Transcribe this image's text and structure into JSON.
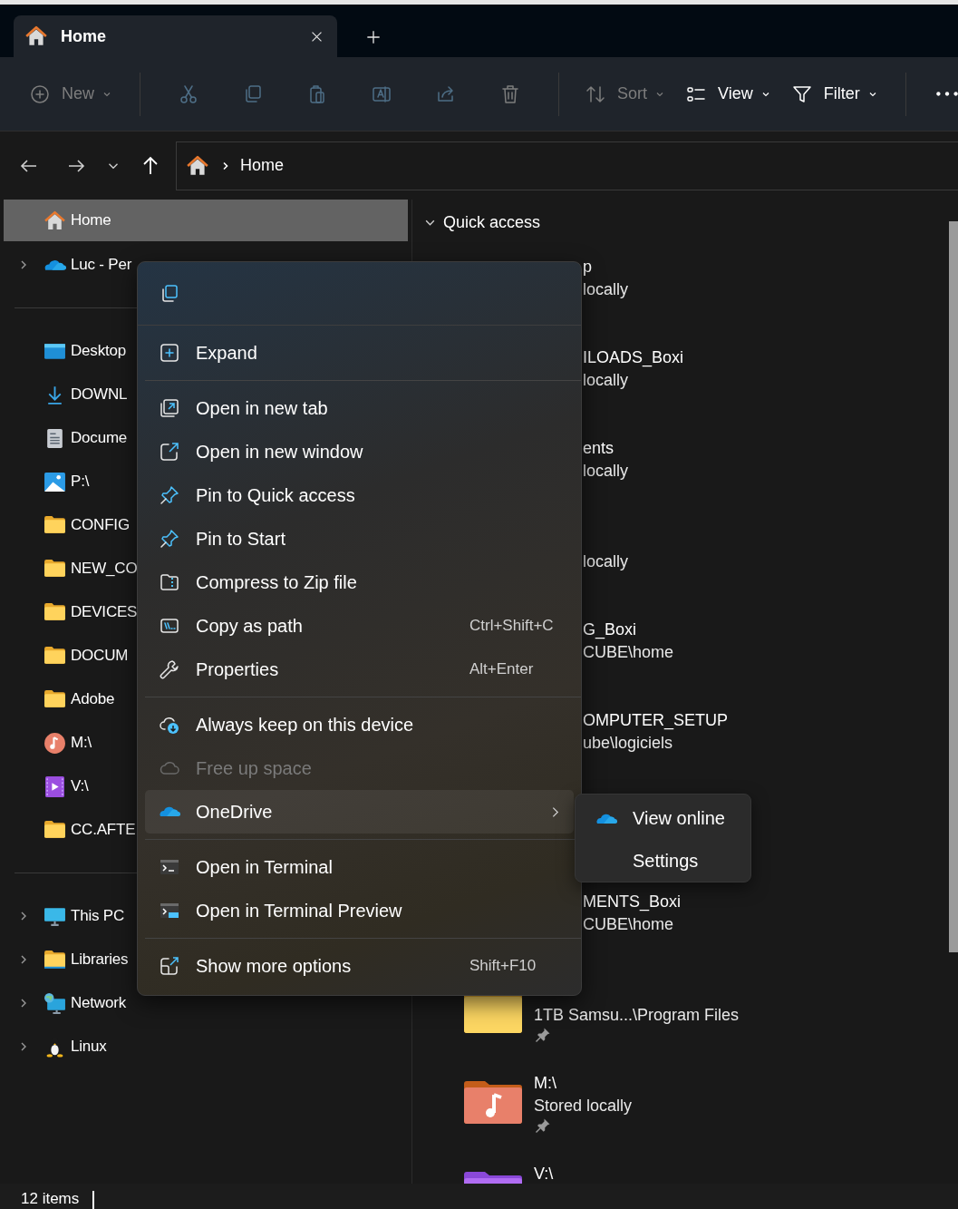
{
  "window": {
    "tabs": [
      {
        "label": "Home",
        "selected": true
      }
    ]
  },
  "toolbar": [
    {
      "kind": "new",
      "label": "New",
      "disabled": true,
      "dropdown": true,
      "separator_after": true
    },
    {
      "kind": "cut",
      "disabled": true,
      "dropdown": false,
      "separator_after": false
    },
    {
      "kind": "copy",
      "disabled": true,
      "dropdown": false,
      "separator_after": false
    },
    {
      "kind": "paste",
      "disabled": true,
      "dropdown": false,
      "separator_after": false
    },
    {
      "kind": "rename",
      "disabled": true,
      "dropdown": false,
      "separator_after": false
    },
    {
      "kind": "share",
      "disabled": true,
      "dropdown": false,
      "separator_after": false
    },
    {
      "kind": "delete",
      "disabled": true,
      "dropdown": false,
      "separator_after": true
    },
    {
      "kind": "sort",
      "label": "Sort",
      "disabled": true,
      "dropdown": true,
      "separator_after": false
    },
    {
      "kind": "view",
      "label": "View",
      "disabled": false,
      "dropdown": true,
      "separator_after": false
    },
    {
      "kind": "filter",
      "label": "Filter",
      "disabled": false,
      "dropdown": true,
      "separator_after": true
    },
    {
      "kind": "more",
      "disabled": false,
      "dropdown": false,
      "separator_after": false
    }
  ],
  "address_bar": {
    "crumbs": [
      "Home"
    ]
  },
  "sidebar": {
    "sections": [
      {
        "items": [
          {
            "label": "Home",
            "kind": "home",
            "selected": true,
            "expandable": false
          },
          {
            "label": "Luc - Per",
            "kind": "cloud",
            "selected": false,
            "expandable": true
          }
        ]
      },
      {
        "items": [
          {
            "label": "Desktop",
            "kind": "desktop",
            "selected": false,
            "expandable": false
          },
          {
            "label": "DOWNL",
            "kind": "download",
            "selected": false,
            "expandable": false
          },
          {
            "label": "Docume",
            "kind": "document",
            "selected": false,
            "expandable": false
          },
          {
            "label": "P:\\",
            "kind": "pictures",
            "selected": false,
            "expandable": false
          },
          {
            "label": "CONFIG",
            "kind": "folder",
            "selected": false,
            "expandable": false
          },
          {
            "label": "NEW_CO",
            "kind": "folder",
            "selected": false,
            "expandable": false
          },
          {
            "label": "DEVICES",
            "kind": "folder",
            "selected": false,
            "expandable": false
          },
          {
            "label": "DOCUM",
            "kind": "folder",
            "selected": false,
            "expandable": false
          },
          {
            "label": "Adobe",
            "kind": "folder",
            "selected": false,
            "expandable": false
          },
          {
            "label": "M:\\",
            "kind": "music",
            "selected": false,
            "expandable": false
          },
          {
            "label": "V:\\",
            "kind": "video",
            "selected": false,
            "expandable": false
          },
          {
            "label": "CC.AFTE",
            "kind": "folder",
            "selected": false,
            "expandable": false
          }
        ]
      },
      {
        "items": [
          {
            "label": "This PC",
            "kind": "pc",
            "selected": false,
            "expandable": true
          },
          {
            "label": "Libraries",
            "kind": "libraries",
            "selected": false,
            "expandable": true
          },
          {
            "label": "Network",
            "kind": "network",
            "selected": false,
            "expandable": true
          },
          {
            "label": "Linux",
            "kind": "linux",
            "selected": false,
            "expandable": true
          }
        ]
      }
    ]
  },
  "content": {
    "group": {
      "label": "Quick access",
      "expanded": true
    },
    "items": [
      {
        "kind": "partial",
        "name": "p",
        "detail": "locally",
        "spaced": false
      },
      {
        "kind": "partial",
        "name": "ILOADS_Boxi",
        "detail": "locally",
        "spaced": false
      },
      {
        "kind": "partial",
        "name": "ents",
        "detail": "locally",
        "spaced": false
      },
      {
        "kind": "partial",
        "detail": "locally",
        "spaced": false
      },
      {
        "kind": "partial",
        "name": "G_Boxi",
        "detail": "CUBE\\home",
        "spaced": false
      },
      {
        "kind": "partial",
        "name": "OMPUTER_SETUP",
        "detail": "ube\\logiciels",
        "spaced": false
      },
      {
        "kind": "partial",
        "name": "MENTS_Boxi",
        "detail": "CUBE\\home",
        "spaced": true
      },
      {
        "kind": "folder",
        "detail": "1TB Samsu...\\Program Files",
        "pinned": true,
        "spaced": false
      },
      {
        "kind": "music",
        "name": "M:\\",
        "detail": "Stored locally",
        "pinned": true,
        "spaced": false
      },
      {
        "kind": "video",
        "name": "V:\\",
        "pinned": false,
        "spaced": false
      }
    ]
  },
  "context_menu": {
    "icon_bar": [
      {
        "kind": "copy"
      }
    ],
    "groups": [
      [
        {
          "kind": "expand",
          "label": "Expand",
          "disabled": false,
          "highlighted": false,
          "submenu": false
        }
      ],
      [
        {
          "kind": "newtab",
          "label": "Open in new tab",
          "disabled": false,
          "highlighted": false,
          "submenu": false
        },
        {
          "kind": "newwindow",
          "label": "Open in new window",
          "disabled": false,
          "highlighted": false,
          "submenu": false
        },
        {
          "kind": "pin",
          "label": "Pin to Quick access",
          "disabled": false,
          "highlighted": false,
          "submenu": false
        },
        {
          "kind": "pin",
          "label": "Pin to Start",
          "disabled": false,
          "highlighted": false,
          "submenu": false
        },
        {
          "kind": "zip",
          "label": "Compress to Zip file",
          "disabled": false,
          "highlighted": false,
          "submenu": false
        },
        {
          "kind": "copypath",
          "label": "Copy as path",
          "shortcut": "Ctrl+Shift+C",
          "disabled": false,
          "highlighted": false,
          "submenu": false
        },
        {
          "kind": "properties",
          "label": "Properties",
          "shortcut": "Alt+Enter",
          "disabled": false,
          "highlighted": false,
          "submenu": false
        }
      ],
      [
        {
          "kind": "keep",
          "label": "Always keep on this device",
          "disabled": false,
          "highlighted": false,
          "submenu": false
        },
        {
          "kind": "free",
          "label": "Free up space",
          "disabled": true,
          "highlighted": false,
          "submenu": false
        },
        {
          "kind": "onedrive",
          "label": "OneDrive",
          "disabled": false,
          "highlighted": true,
          "submenu": true
        }
      ],
      [
        {
          "kind": "terminal",
          "label": "Open in Terminal",
          "disabled": false,
          "highlighted": false,
          "submenu": false
        },
        {
          "kind": "terminalpreview",
          "label": "Open in Terminal Preview",
          "disabled": false,
          "highlighted": false,
          "submenu": false
        }
      ],
      [
        {
          "kind": "more",
          "label": "Show more options",
          "shortcut": "Shift+F10",
          "disabled": false,
          "highlighted": false,
          "submenu": false
        }
      ]
    ]
  },
  "submenu": {
    "items": [
      {
        "kind": "onedrive",
        "label": "View online"
      },
      {
        "kind": "plain",
        "label": "Settings"
      }
    ]
  },
  "status_bar": {
    "count": "12 items"
  }
}
